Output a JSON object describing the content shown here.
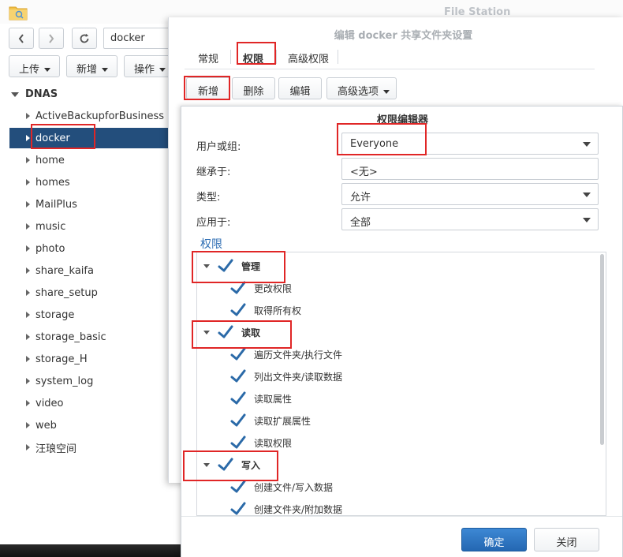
{
  "file_station": {
    "title": "File Station",
    "path": "docker",
    "toolbar": {
      "upload": "上传",
      "create": "新增",
      "action": "操作"
    },
    "tree_root": "DNAS",
    "folders": [
      "ActiveBackupforBusiness",
      "docker",
      "home",
      "homes",
      "MailPlus",
      "music",
      "photo",
      "share_kaifa",
      "share_setup",
      "storage",
      "storage_basic",
      "storage_H",
      "system_log",
      "video",
      "web",
      "汪琅空间"
    ],
    "selected_folder": "docker"
  },
  "properties_dialog": {
    "title": "编辑 docker 共享文件夹设置",
    "tabs": [
      "常规",
      "权限",
      "高级权限"
    ],
    "active_tab": "权限",
    "toolbar": {
      "add": "新增",
      "delete": "删除",
      "edit": "编辑",
      "advanced": "高级选项"
    }
  },
  "permission_editor": {
    "title": "权限编辑器",
    "fields": [
      {
        "label": "用户或组:",
        "value": "Everyone",
        "dropdown": true
      },
      {
        "label": "继承于:",
        "value": "<无>",
        "dropdown": false
      },
      {
        "label": "类型:",
        "value": "允许",
        "dropdown": true
      },
      {
        "label": "应用于:",
        "value": "全部",
        "dropdown": true
      }
    ],
    "section_title": "权限",
    "groups": [
      {
        "name": "管理",
        "checked": true,
        "items": [
          {
            "label": "更改权限",
            "checked": true
          },
          {
            "label": "取得所有权",
            "checked": true
          }
        ]
      },
      {
        "name": "读取",
        "checked": true,
        "items": [
          {
            "label": "遍历文件夹/执行文件",
            "checked": true
          },
          {
            "label": "列出文件夹/读取数据",
            "checked": true
          },
          {
            "label": "读取属性",
            "checked": true
          },
          {
            "label": "读取扩展属性",
            "checked": true
          },
          {
            "label": "读取权限",
            "checked": true
          }
        ]
      },
      {
        "name": "写入",
        "checked": true,
        "items": [
          {
            "label": "创建文件/写入数据",
            "checked": true
          },
          {
            "label": "创建文件夹/附加数据",
            "checked": true
          }
        ]
      }
    ],
    "ok_label": "确定",
    "close_label": "关闭"
  },
  "colors": {
    "accent": "#2467b2",
    "selection": "#234e7c",
    "highlight": "#e02626",
    "check": "#2b6aa8"
  }
}
